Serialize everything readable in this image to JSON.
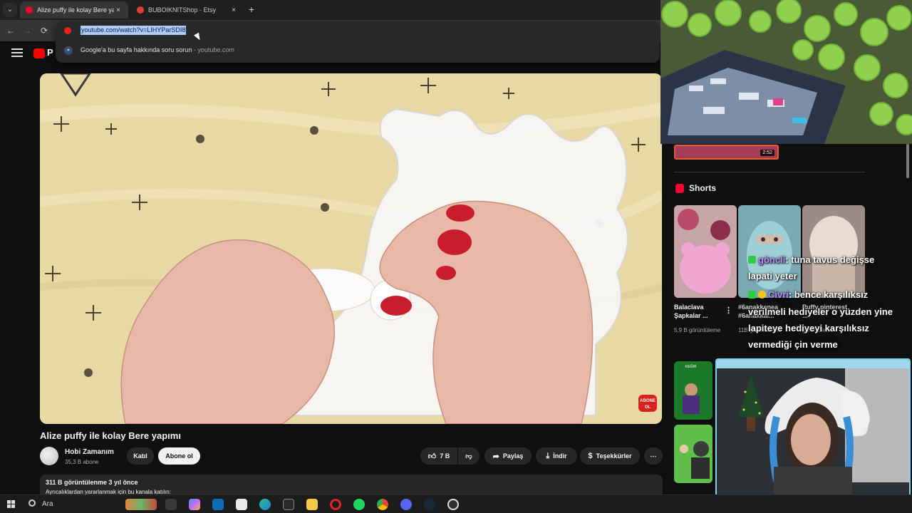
{
  "browser": {
    "tabs": [
      {
        "title": "Alize puffy ile kolay Bere yapımı",
        "close": "×",
        "favicon_color": "#ff0033"
      },
      {
        "title": "BUBOIKNITShop - Etsy",
        "close": "×",
        "favicon_color": "#e33b3b"
      }
    ],
    "new_tab": "+",
    "tab_menu": "⌄",
    "nav": {
      "back": "←",
      "forward": "→",
      "reload": "⟳"
    },
    "omnibox": {
      "url": "youtube.com/watch?v=LIHYParSDI8",
      "suggestion": "Google'a bu sayfa hakkında soru sorun",
      "suggestion_domain": " - youtube.com"
    }
  },
  "youtube": {
    "logo_partial": "P",
    "video": {
      "title": "Alize puffy ile kolay Bere yapımı",
      "overlay_badge": "ABONE OL"
    },
    "channel": {
      "name": "Hobi Zamanım",
      "subscribers": "35,3 B abone",
      "join_label": "Katıl",
      "subscribe_label": "Abone ol"
    },
    "actions": {
      "likes": "7 B",
      "share": "Paylaş",
      "download": "İndir",
      "thanks": "Teşekkürler",
      "more": "⋯"
    },
    "description": {
      "views": "311 B görüntülenme  3 yıl önce",
      "line": "Ayrıcalıklardan yararlanmak için bu kanala katılın:"
    },
    "sidebar": {
      "top_thumb_duration": "2:52",
      "shorts_heading": "Shorts",
      "shorts": [
        {
          "title": "Balaclava Şapkalar ...",
          "views": "5,9 B görüntüleme"
        },
        {
          "title": "#6anakkenea #6anakkal...",
          "views": "11B görüntüleme"
        },
        {
          "title": "Puffy pinterest ...",
          "views": "görüntüleme"
        }
      ],
      "card_label": "KEĞRİ"
    }
  },
  "stream": {
    "chat": [
      {
        "user": "göncli",
        "text": ": tuna tavus değişse"
      },
      {
        "user": "",
        "text": "lapati yeter"
      },
      {
        "user": "Civri",
        "text": ": bence karşılıksız"
      },
      {
        "user": "",
        "text": "verilmeli hediyeler o yüzden yine"
      },
      {
        "user": "",
        "text": "lapiteye hediyeyi karşılıksız"
      },
      {
        "user": "",
        "text": "vermediği çin verme"
      }
    ],
    "cam_frame_color": "#7ad3f0"
  },
  "taskbar": {
    "search_label": "Ara",
    "icons": [
      "game-thumb",
      "task-view",
      "copilot",
      "outlook",
      "store",
      "edge",
      "epic-games",
      "file-explorer",
      "opera",
      "spotify",
      "chrome",
      "discord",
      "steam",
      "obs"
    ]
  }
}
